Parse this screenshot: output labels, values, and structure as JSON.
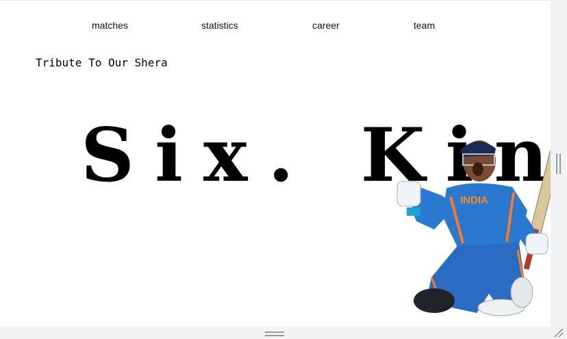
{
  "nav": {
    "items": [
      {
        "label": "matches"
      },
      {
        "label": "statistics"
      },
      {
        "label": "career"
      },
      {
        "label": "team"
      }
    ]
  },
  "page": {
    "subtitle": "Tribute To Our Shera",
    "headline": "Six. King"
  },
  "player_image": {
    "jersey_text": "INDIA"
  }
}
